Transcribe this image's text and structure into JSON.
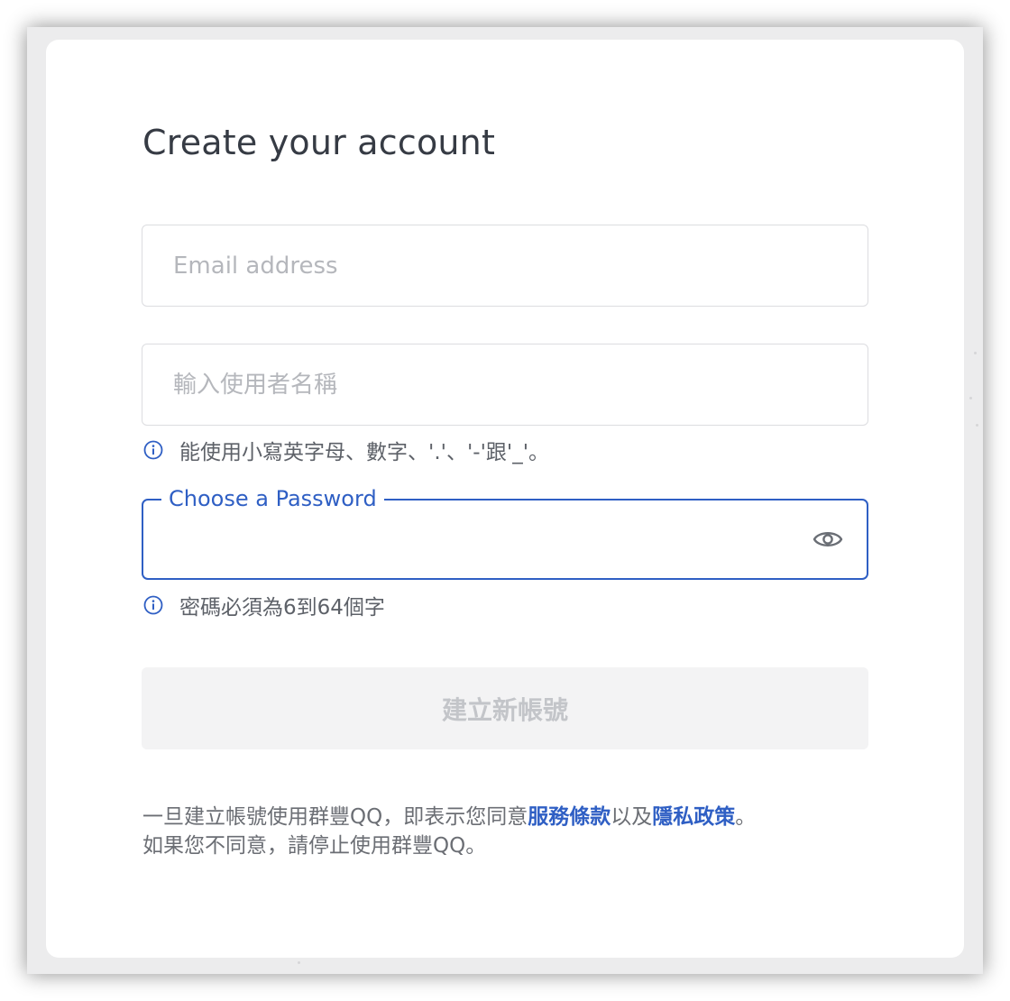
{
  "form": {
    "title": "Create your account",
    "email": {
      "placeholder": "Email address",
      "value": ""
    },
    "username": {
      "placeholder": "輸入使用者名稱",
      "value": "",
      "hint": "能使用小寫英字母、數字、'.'、'-'跟'_'。"
    },
    "password": {
      "label": "Choose a Password",
      "value": "",
      "hint": "密碼必須為6到64個字"
    },
    "submit_label": "建立新帳號"
  },
  "terms": {
    "prefix": "一旦建立帳號使用群豐QQ，即表示您同意",
    "tos_link": "服務條款",
    "middle": "以及",
    "privacy_link": "隱私政策",
    "suffix": "。",
    "line2": "如果您不同意，請停止使用群豐QQ。"
  },
  "colors": {
    "accent": "#2f5fc4",
    "title_text": "#363b44",
    "disabled_button_bg": "#f3f3f4",
    "disabled_button_text": "#c3c5c9"
  },
  "icons": {
    "info": "info-circle-icon",
    "password_toggle": "eye-icon"
  }
}
